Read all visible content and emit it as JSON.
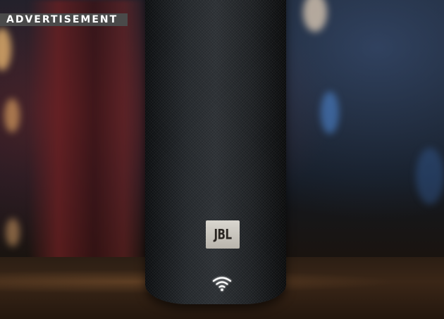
{
  "ad": {
    "label": "ADVERTISEMENT",
    "brand_badge_text": "JBL",
    "status_icon": "wifi-icon",
    "colors": {
      "label_background": "#4a4a4a",
      "label_text": "#ffffff",
      "wifi_glow": "#ffffff",
      "speaker_body": "#23272b"
    }
  }
}
